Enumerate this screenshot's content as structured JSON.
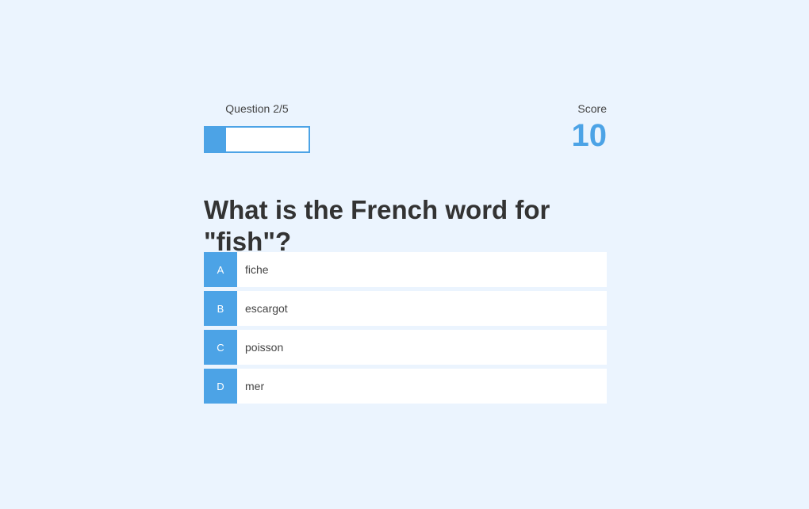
{
  "hud": {
    "question_counter": "Question 2/5",
    "progress_fraction": 0.2,
    "score_label": "Score",
    "score_value": "10"
  },
  "question": {
    "text": "What is the French word for \"fish\"?"
  },
  "choices": [
    {
      "letter": "A",
      "text": "fiche"
    },
    {
      "letter": "B",
      "text": "escargot"
    },
    {
      "letter": "C",
      "text": "poisson"
    },
    {
      "letter": "D",
      "text": "mer"
    }
  ],
  "colors": {
    "accent": "#4ca3e6",
    "background": "#ebf4fe",
    "text": "#333333"
  }
}
